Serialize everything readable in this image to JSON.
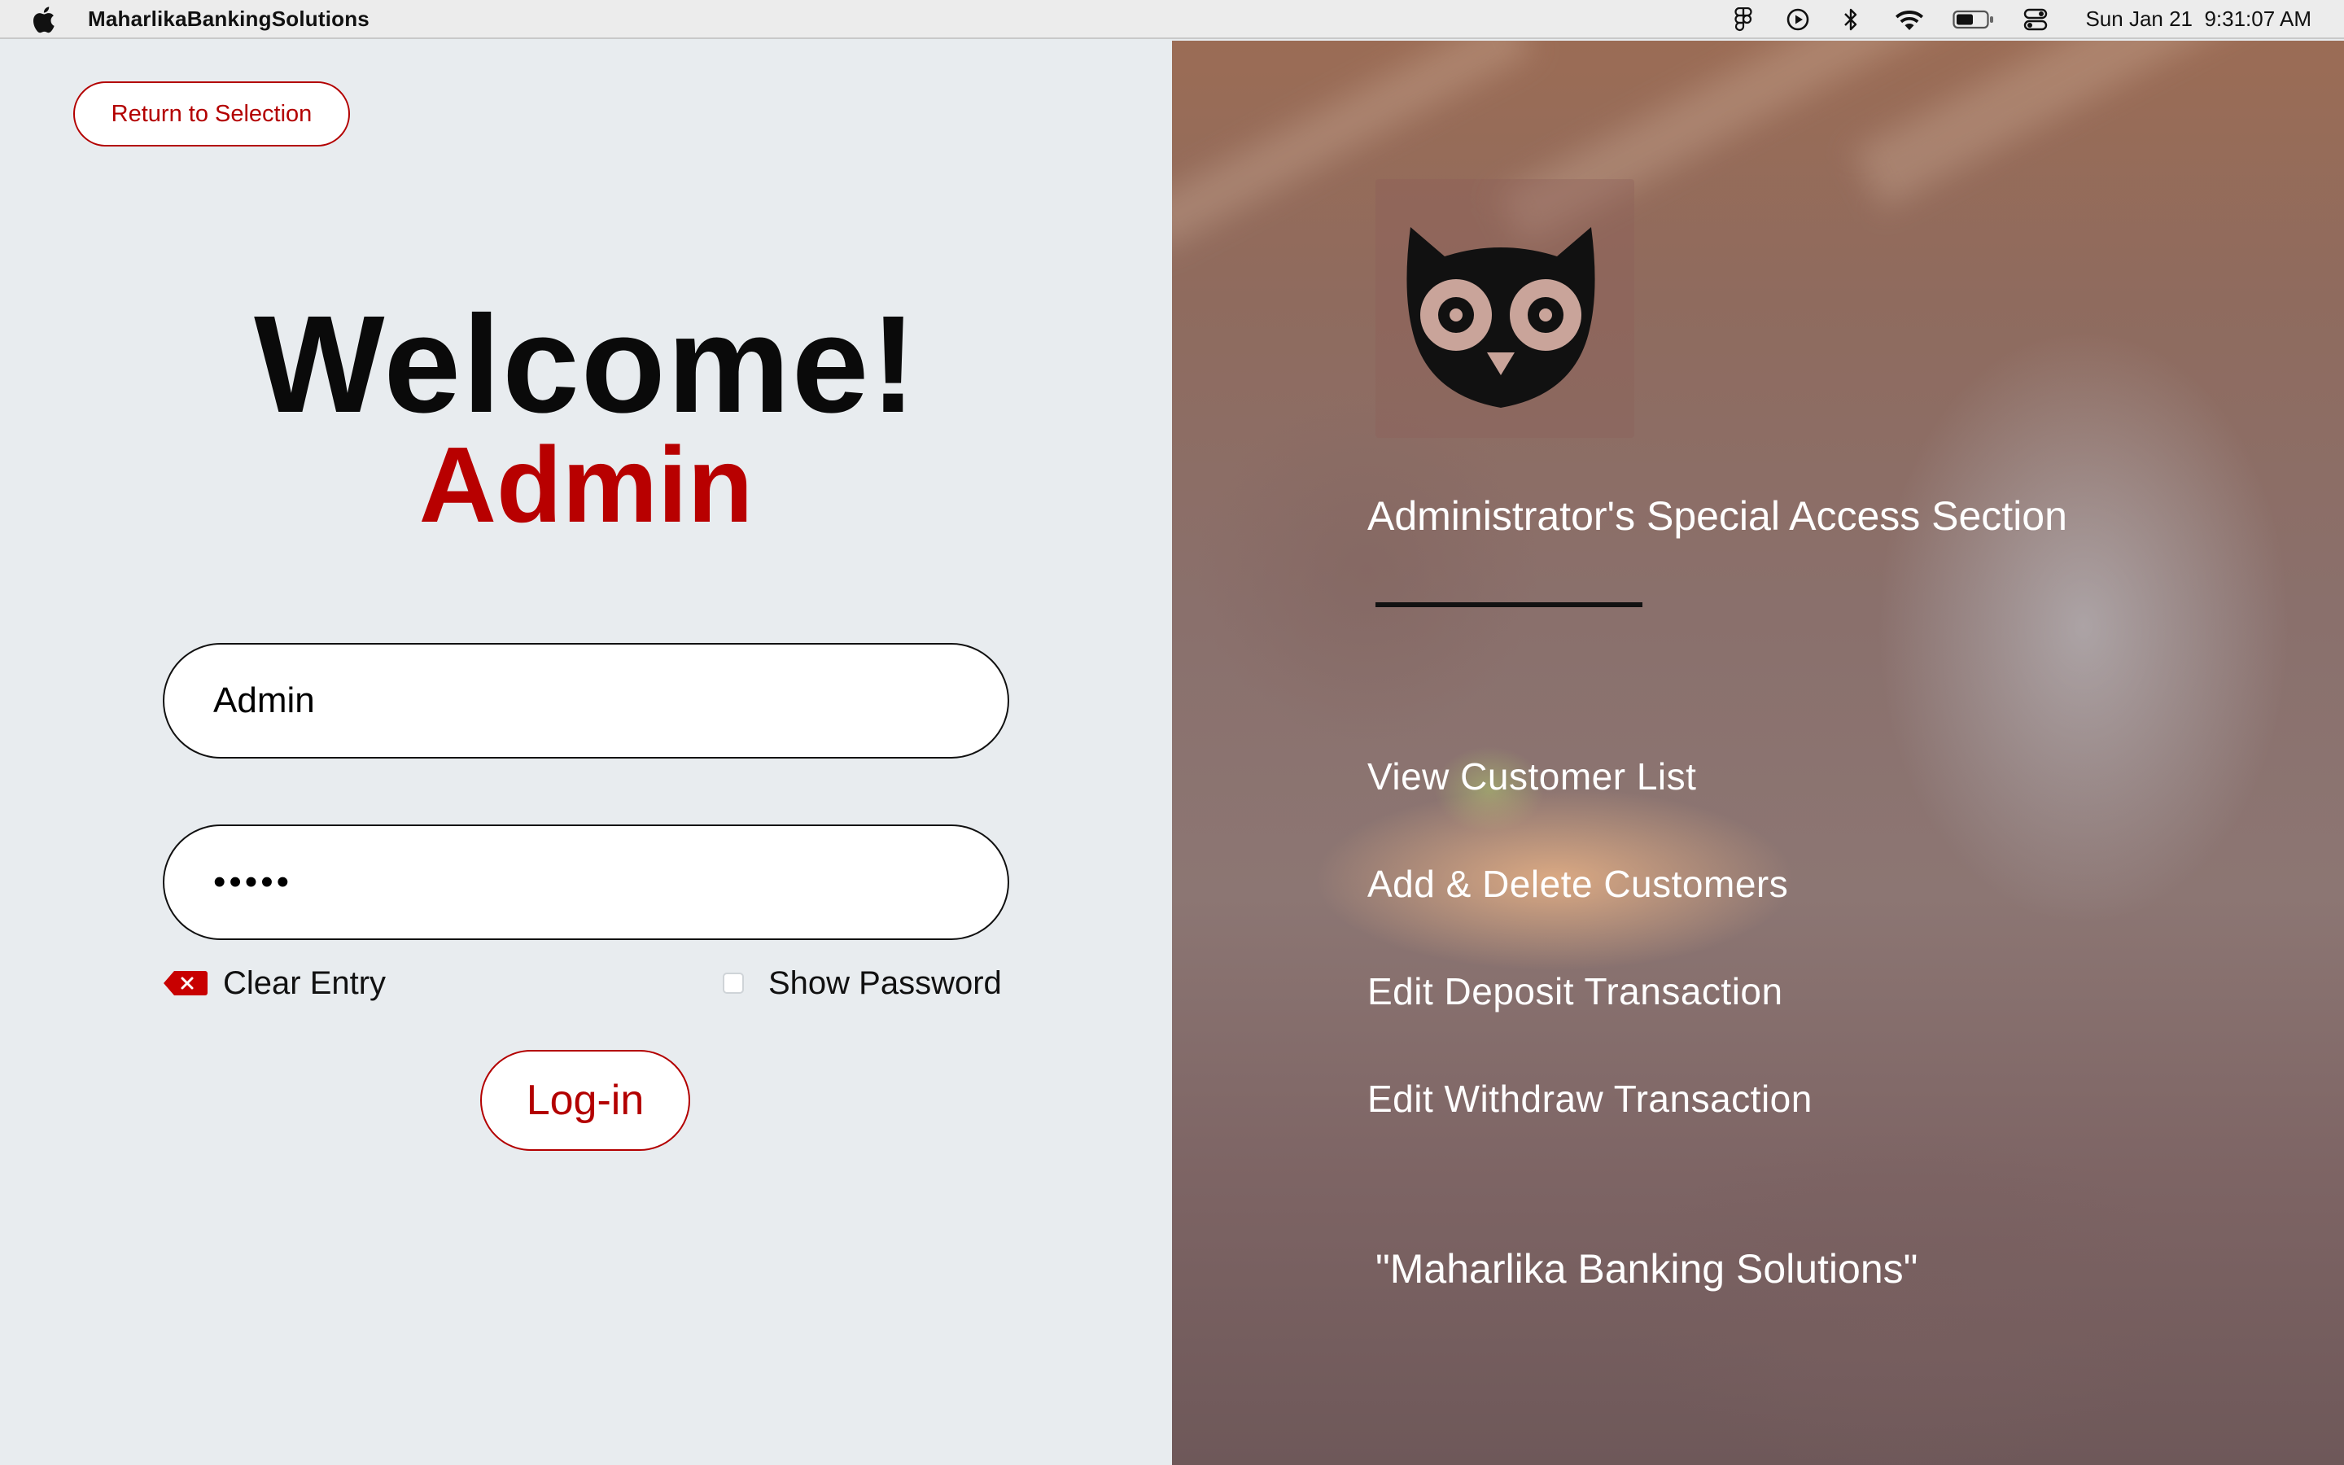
{
  "menubar": {
    "app_name": "MaharlikaBankingSolutions",
    "clock": "Sun Jan 21  9:31:07 AM",
    "status_icons": [
      "figma-icon",
      "play-circle-icon",
      "bluetooth-icon",
      "wifi-icon",
      "battery-icon",
      "control-center-icon"
    ]
  },
  "login": {
    "return_label": "Return to Selection",
    "welcome": "Welcome!",
    "role": "Admin",
    "username_value": "Admin",
    "password_value": "•••••",
    "clear_label": "Clear Entry",
    "show_password_label": "Show Password",
    "show_password_checked": false,
    "login_label": "Log-in"
  },
  "panel": {
    "section_title": "Administrator's Special Access Section",
    "links": [
      "View Customer List",
      "Add & Delete Customers",
      "Edit Deposit Transaction",
      "Edit Withdraw Transaction"
    ],
    "quote": "\"Maharlika Banking Solutions\""
  },
  "colors": {
    "accent_red": "#b30000",
    "left_background": "#e8ecef",
    "menubar_background": "#ececec"
  }
}
